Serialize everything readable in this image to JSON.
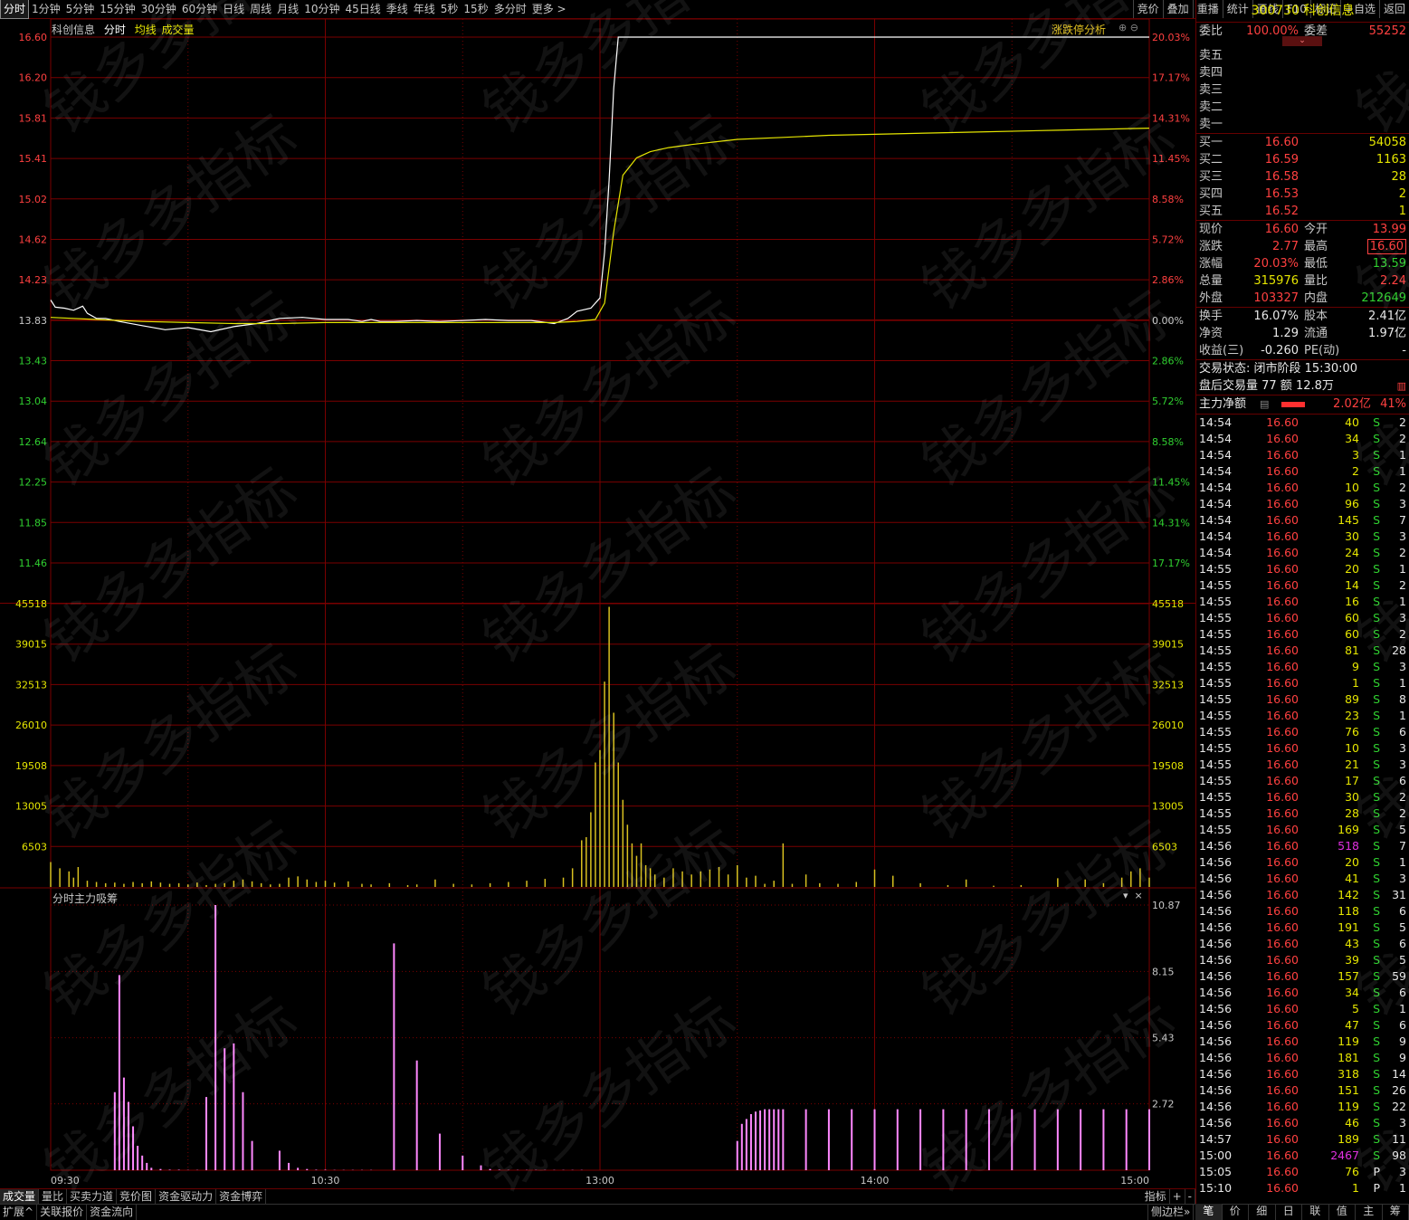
{
  "periods": [
    "分时",
    "1分钟",
    "5分钟",
    "15分钟",
    "30分钟",
    "60分钟",
    "日线",
    "周线",
    "月线",
    "10分钟",
    "45日线",
    "季线",
    "年线",
    "5秒",
    "15秒",
    "多分时",
    "更多 >"
  ],
  "toolbar": [
    "竞价",
    "叠加",
    "重播",
    "统计",
    "画线",
    "F10",
    "标记",
    "+自选",
    "返回"
  ],
  "legend": {
    "name": "科创信息",
    "fenshi": "分时",
    "avg": "均线",
    "vol": "成交量"
  },
  "zt_label": "涨跌停分析",
  "sub_title": "分时主力吸筹",
  "watermark": "钱多多指标",
  "colors": {
    "grid": "#7a0000",
    "price": "#ffffff",
    "avg": "#e6e600",
    "vol": "#d8c020",
    "sub": "#ff88ff",
    "up": "#ff4040",
    "down": "#30d030"
  },
  "chart_data": [
    {
      "type": "line",
      "y_ticks_left": [
        "16.60",
        "16.20",
        "15.81",
        "15.41",
        "15.02",
        "14.62",
        "14.23",
        "13.83",
        "13.43",
        "13.04",
        "12.64",
        "12.25",
        "11.85",
        "11.46"
      ],
      "y_ticks_right": [
        "20.03%",
        "17.17%",
        "14.31%",
        "11.45%",
        "8.58%",
        "5.72%",
        "2.86%",
        "0.00%",
        "2.86%",
        "5.72%",
        "8.58%",
        "11.45%",
        "14.31%",
        "17.17%"
      ],
      "ylim": [
        11.46,
        16.6
      ],
      "prev_close": 13.83,
      "x_labels": [
        "09:30",
        "10:30",
        "13:00",
        "14:00",
        "15:00"
      ],
      "series": [
        {
          "name": "分时",
          "x": [
            0,
            1,
            3,
            5,
            7,
            8,
            10,
            12,
            15,
            20,
            25,
            30,
            35,
            40,
            45,
            50,
            55,
            60,
            65,
            68,
            70,
            72,
            75,
            80,
            85,
            90,
            95,
            100,
            105,
            110,
            113,
            115,
            118,
            120,
            121,
            122,
            123,
            124,
            125,
            130,
            140,
            150,
            160,
            170,
            180,
            200,
            220,
            240
          ],
          "values": [
            14.03,
            13.96,
            13.95,
            13.93,
            13.97,
            13.9,
            13.85,
            13.85,
            13.82,
            13.78,
            13.74,
            13.76,
            13.72,
            13.77,
            13.8,
            13.85,
            13.86,
            13.84,
            13.84,
            13.82,
            13.84,
            13.82,
            13.82,
            13.83,
            13.82,
            13.83,
            13.84,
            13.83,
            13.83,
            13.8,
            13.85,
            13.92,
            13.95,
            14.05,
            14.5,
            15.2,
            16.1,
            16.6,
            16.6,
            16.6,
            16.6,
            16.6,
            16.6,
            16.6,
            16.6,
            16.6,
            16.6,
            16.6
          ]
        },
        {
          "name": "均线",
          "x": [
            0,
            10,
            20,
            30,
            40,
            50,
            60,
            70,
            80,
            90,
            100,
            110,
            115,
            119,
            121,
            123,
            125,
            128,
            131,
            135,
            140,
            150,
            160,
            170,
            180,
            200,
            220,
            240
          ],
          "values": [
            13.86,
            13.84,
            13.82,
            13.81,
            13.8,
            13.8,
            13.81,
            13.81,
            13.81,
            13.81,
            13.81,
            13.81,
            13.82,
            13.84,
            14.0,
            14.7,
            15.25,
            15.42,
            15.48,
            15.52,
            15.55,
            15.6,
            15.62,
            15.64,
            15.65,
            15.67,
            15.69,
            15.71
          ]
        }
      ]
    },
    {
      "type": "bar",
      "name": "成交量",
      "y_ticks": [
        "45518",
        "39015",
        "32513",
        "26010",
        "19508",
        "13005",
        "6503"
      ],
      "ylim": [
        0,
        45518
      ],
      "x": [
        0,
        2,
        4,
        5,
        6,
        8,
        10,
        12,
        14,
        16,
        18,
        20,
        22,
        24,
        26,
        28,
        30,
        32,
        34,
        36,
        38,
        40,
        42,
        44,
        46,
        48,
        50,
        52,
        54,
        56,
        58,
        60,
        62,
        65,
        68,
        70,
        74,
        78,
        80,
        84,
        88,
        92,
        96,
        100,
        104,
        108,
        112,
        114,
        116,
        117,
        118,
        119,
        120,
        121,
        122,
        123,
        124,
        125,
        126,
        127,
        128,
        129,
        130,
        131,
        132,
        134,
        136,
        138,
        140,
        142,
        144,
        146,
        148,
        150,
        152,
        154,
        156,
        158,
        160,
        162,
        165,
        168,
        172,
        176,
        180,
        184,
        190,
        196,
        200,
        206,
        212,
        220,
        226,
        230,
        234,
        236,
        238,
        240
      ],
      "values": [
        4000,
        3000,
        2500,
        1500,
        3200,
        1000,
        800,
        600,
        700,
        500,
        800,
        600,
        900,
        700,
        500,
        600,
        400,
        700,
        300,
        500,
        600,
        1000,
        1200,
        900,
        600,
        400,
        500,
        1500,
        1700,
        1200,
        800,
        1000,
        700,
        900,
        500,
        400,
        600,
        300,
        400,
        1200,
        500,
        400,
        600,
        800,
        1000,
        1300,
        1500,
        3000,
        7500,
        8000,
        12000,
        20000,
        22000,
        33000,
        45000,
        28000,
        20000,
        14000,
        10000,
        7000,
        5000,
        7000,
        3500,
        3000,
        2000,
        1500,
        3000,
        2500,
        2000,
        2500,
        2800,
        3200,
        2000,
        3500,
        1500,
        1800,
        500,
        1000,
        7000,
        500,
        2000,
        600,
        500,
        800,
        2800,
        1800,
        600,
        300,
        1200,
        200,
        300,
        1400,
        1200,
        600,
        1500,
        2500,
        3000,
        1500
      ]
    },
    {
      "type": "bar",
      "name": "分时主力吸筹",
      "y_ticks": [
        "10.87",
        "8.15",
        "5.43",
        "2.72"
      ],
      "ylim": [
        0,
        10.87
      ],
      "x": [
        14,
        15,
        16,
        17,
        18,
        19,
        20,
        21,
        22,
        24,
        26,
        28,
        30,
        32,
        34,
        36,
        38,
        40,
        42,
        44,
        50,
        52,
        54,
        56,
        58,
        60,
        62,
        64,
        66,
        68,
        70,
        75,
        80,
        85,
        90,
        94,
        96,
        98,
        100,
        102,
        104,
        106,
        108,
        110,
        112,
        114,
        116,
        150,
        151,
        152,
        153,
        154,
        155,
        156,
        157,
        158,
        159,
        160,
        165,
        170,
        175,
        180,
        185,
        190,
        195,
        200,
        205,
        210,
        215,
        220,
        225,
        230,
        235,
        240
      ],
      "values": [
        3.2,
        8.0,
        3.8,
        2.8,
        1.8,
        1.0,
        0.6,
        0.3,
        0.1,
        0.05,
        0.02,
        0.02,
        0.01,
        0.01,
        3.0,
        10.87,
        5.0,
        5.2,
        3.2,
        1.2,
        0.8,
        0.3,
        0.1,
        0.05,
        0.02,
        0.02,
        0.01,
        0.01,
        0.01,
        0.01,
        0.01,
        9.3,
        4.5,
        1.5,
        0.6,
        0.2,
        0.05,
        0.02,
        0.01,
        0.01,
        0.01,
        0.01,
        0.01,
        0.01,
        0.01,
        0.01,
        0.01,
        1.2,
        1.9,
        2.1,
        2.3,
        2.4,
        2.45,
        2.5,
        2.5,
        2.5,
        2.5,
        2.5,
        2.5,
        2.5,
        2.5,
        2.5,
        2.5,
        2.5,
        2.5,
        2.5,
        2.5,
        2.5,
        2.5,
        2.5,
        2.5,
        2.5,
        2.5,
        2.5
      ]
    }
  ],
  "sidebar": {
    "title": "300730 科创信息",
    "wei": {
      "l1": "委比",
      "v1": "100.00%",
      "l2": "委差",
      "v2": "55252"
    },
    "sells": [
      "卖五",
      "卖四",
      "卖三",
      "卖二",
      "卖一"
    ],
    "buys": [
      {
        "l": "买一",
        "p": "16.60",
        "q": "54058"
      },
      {
        "l": "买二",
        "p": "16.59",
        "q": "1163"
      },
      {
        "l": "买三",
        "p": "16.58",
        "q": "28"
      },
      {
        "l": "买四",
        "p": "16.53",
        "q": "2"
      },
      {
        "l": "买五",
        "p": "16.52",
        "q": "1"
      }
    ],
    "quote": [
      {
        "l1": "现价",
        "v1": "16.60",
        "c1": "red",
        "l2": "今开",
        "v2": "13.99",
        "c2": "red"
      },
      {
        "l1": "涨跌",
        "v1": "2.77",
        "c1": "red",
        "l2": "最高",
        "v2": "16.60",
        "c2": "red"
      },
      {
        "l1": "涨幅",
        "v1": "20.03%",
        "c1": "red",
        "l2": "最低",
        "v2": "13.59",
        "c2": "grn"
      },
      {
        "l1": "总量",
        "v1": "315976",
        "c1": "yel",
        "l2": "量比",
        "v2": "2.24",
        "c2": "red"
      },
      {
        "l1": "外盘",
        "v1": "103327",
        "c1": "red",
        "l2": "内盘",
        "v2": "212649",
        "c2": "grn"
      }
    ],
    "fund": [
      {
        "l1": "换手",
        "v1": "16.07%",
        "l2": "股本",
        "v2": "2.41亿"
      },
      {
        "l1": "净资",
        "v1": "1.29",
        "l2": "流通",
        "v2": "1.97亿"
      },
      {
        "l1": "收益(三)",
        "v1": "-0.260",
        "l2": "PE(动)",
        "v2": "-"
      }
    ],
    "status": "交易状态: 闭市阶段 15:30:00",
    "after": "盘后交易量 77 额 12.8万",
    "main_label": "主力净额",
    "main_value": "2.02亿",
    "main_pct": "41%",
    "trades": [
      [
        "14:54",
        "16.60",
        "40",
        "S",
        "2"
      ],
      [
        "14:54",
        "16.60",
        "34",
        "S",
        "2"
      ],
      [
        "14:54",
        "16.60",
        "3",
        "S",
        "1"
      ],
      [
        "14:54",
        "16.60",
        "2",
        "S",
        "1"
      ],
      [
        "14:54",
        "16.60",
        "10",
        "S",
        "2"
      ],
      [
        "14:54",
        "16.60",
        "96",
        "S",
        "3"
      ],
      [
        "14:54",
        "16.60",
        "145",
        "S",
        "7"
      ],
      [
        "14:54",
        "16.60",
        "30",
        "S",
        "3"
      ],
      [
        "14:54",
        "16.60",
        "24",
        "S",
        "2"
      ],
      [
        "14:55",
        "16.60",
        "20",
        "S",
        "1"
      ],
      [
        "14:55",
        "16.60",
        "14",
        "S",
        "2"
      ],
      [
        "14:55",
        "16.60",
        "16",
        "S",
        "1"
      ],
      [
        "14:55",
        "16.60",
        "60",
        "S",
        "3"
      ],
      [
        "14:55",
        "16.60",
        "60",
        "S",
        "2"
      ],
      [
        "14:55",
        "16.60",
        "81",
        "S",
        "28"
      ],
      [
        "14:55",
        "16.60",
        "9",
        "S",
        "3"
      ],
      [
        "14:55",
        "16.60",
        "1",
        "S",
        "1"
      ],
      [
        "14:55",
        "16.60",
        "89",
        "S",
        "8"
      ],
      [
        "14:55",
        "16.60",
        "23",
        "S",
        "1"
      ],
      [
        "14:55",
        "16.60",
        "76",
        "S",
        "6"
      ],
      [
        "14:55",
        "16.60",
        "10",
        "S",
        "3"
      ],
      [
        "14:55",
        "16.60",
        "21",
        "S",
        "3"
      ],
      [
        "14:55",
        "16.60",
        "17",
        "S",
        "6"
      ],
      [
        "14:55",
        "16.60",
        "30",
        "S",
        "2"
      ],
      [
        "14:55",
        "16.60",
        "28",
        "S",
        "2"
      ],
      [
        "14:55",
        "16.60",
        "169",
        "S",
        "5"
      ],
      [
        "14:56",
        "16.60",
        "518",
        "S",
        "7"
      ],
      [
        "14:56",
        "16.60",
        "20",
        "S",
        "1"
      ],
      [
        "14:56",
        "16.60",
        "41",
        "S",
        "3"
      ],
      [
        "14:56",
        "16.60",
        "142",
        "S",
        "31"
      ],
      [
        "14:56",
        "16.60",
        "118",
        "S",
        "6"
      ],
      [
        "14:56",
        "16.60",
        "191",
        "S",
        "5"
      ],
      [
        "14:56",
        "16.60",
        "43",
        "S",
        "6"
      ],
      [
        "14:56",
        "16.60",
        "39",
        "S",
        "5"
      ],
      [
        "14:56",
        "16.60",
        "157",
        "S",
        "59"
      ],
      [
        "14:56",
        "16.60",
        "34",
        "S",
        "6"
      ],
      [
        "14:56",
        "16.60",
        "5",
        "S",
        "1"
      ],
      [
        "14:56",
        "16.60",
        "47",
        "S",
        "6"
      ],
      [
        "14:56",
        "16.60",
        "119",
        "S",
        "9"
      ],
      [
        "14:56",
        "16.60",
        "181",
        "S",
        "9"
      ],
      [
        "14:56",
        "16.60",
        "318",
        "S",
        "14"
      ],
      [
        "14:56",
        "16.60",
        "151",
        "S",
        "26"
      ],
      [
        "14:56",
        "16.60",
        "119",
        "S",
        "22"
      ],
      [
        "14:56",
        "16.60",
        "46",
        "S",
        "3"
      ],
      [
        "14:57",
        "16.60",
        "189",
        "S",
        "11"
      ],
      [
        "15:00",
        "16.60",
        "2467",
        "S",
        "98"
      ],
      [
        "15:05",
        "16.60",
        "76",
        "P",
        "3"
      ],
      [
        "15:10",
        "16.60",
        "1",
        "P",
        "1"
      ]
    ]
  },
  "bottom_tabs": [
    "成交量",
    "量比",
    "买卖力道",
    "竞价图",
    "资金驱动力",
    "资金博弈"
  ],
  "bottom_right": [
    "指标",
    "+",
    "-"
  ],
  "bottom2_tabs": [
    "扩展^",
    "关联报价",
    "资金流向"
  ],
  "bottom2_right": "侧边栏»",
  "side_tabs": [
    "笔",
    "价",
    "细",
    "日",
    "联",
    "值",
    "主",
    "筹"
  ]
}
